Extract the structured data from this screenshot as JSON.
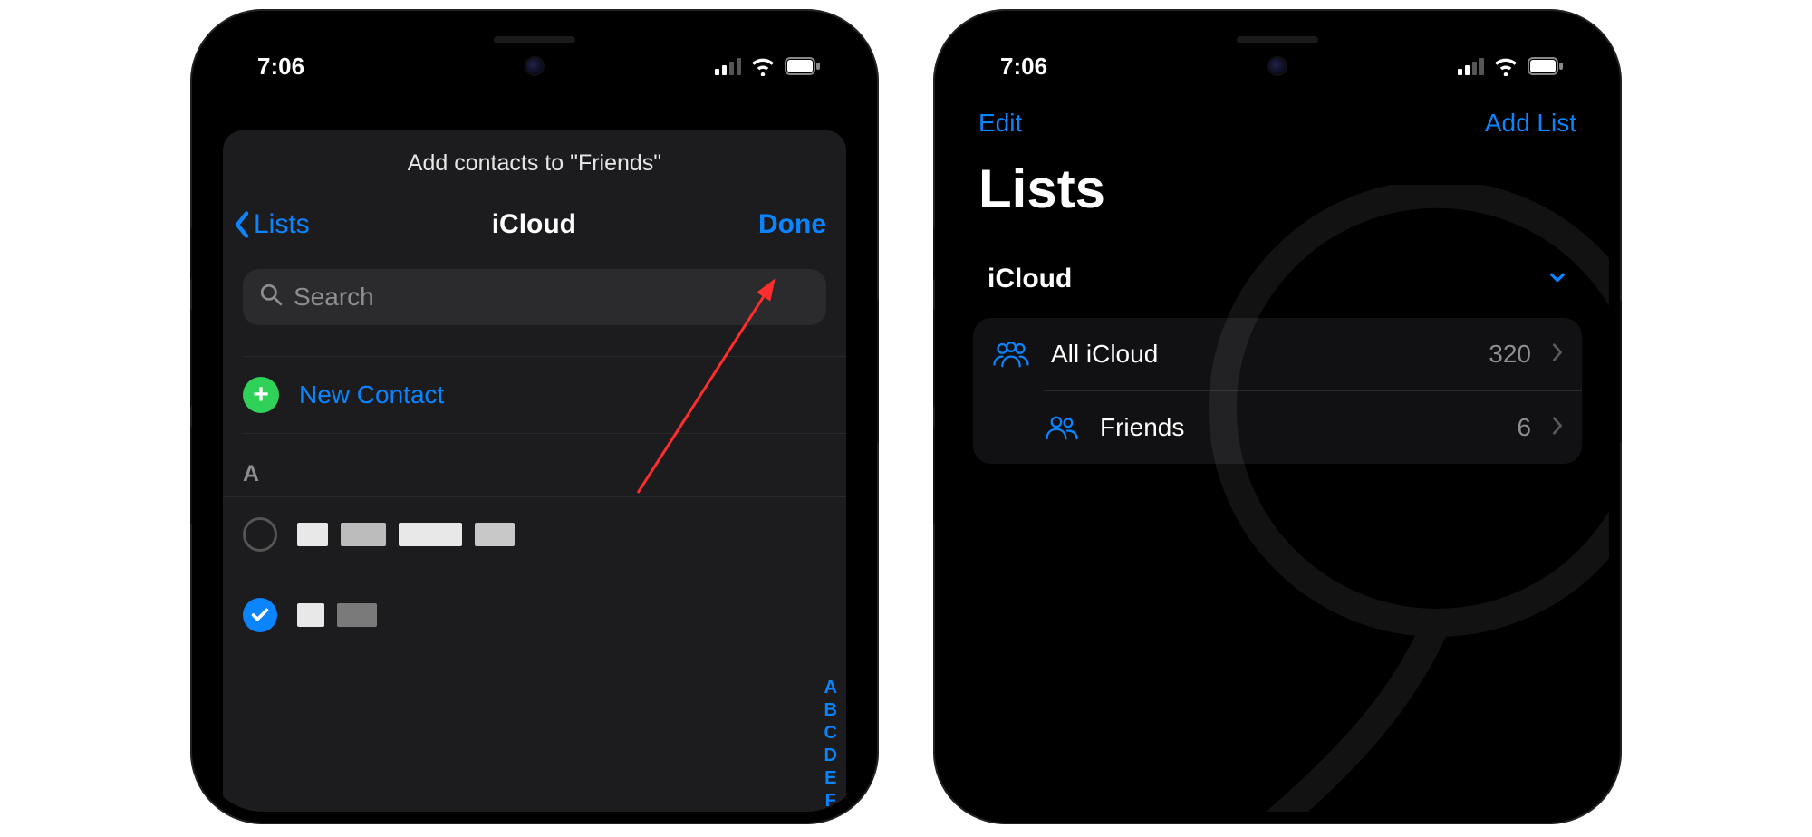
{
  "status": {
    "time": "7:06"
  },
  "phone1": {
    "sheet_title": "Add contacts to \"Friends\"",
    "nav": {
      "back": "Lists",
      "title": "iCloud",
      "done": "Done"
    },
    "search": {
      "placeholder": "Search"
    },
    "new_contact": "New Contact",
    "section_letter": "A",
    "index_rail": [
      "A",
      "B",
      "C",
      "D",
      "E",
      "F"
    ]
  },
  "phone2": {
    "nav": {
      "edit": "Edit",
      "add_list": "Add List"
    },
    "title": "Lists",
    "account": "iCloud",
    "rows": [
      {
        "label": "All iCloud",
        "count": "320"
      },
      {
        "label": "Friends",
        "count": "6"
      }
    ]
  }
}
